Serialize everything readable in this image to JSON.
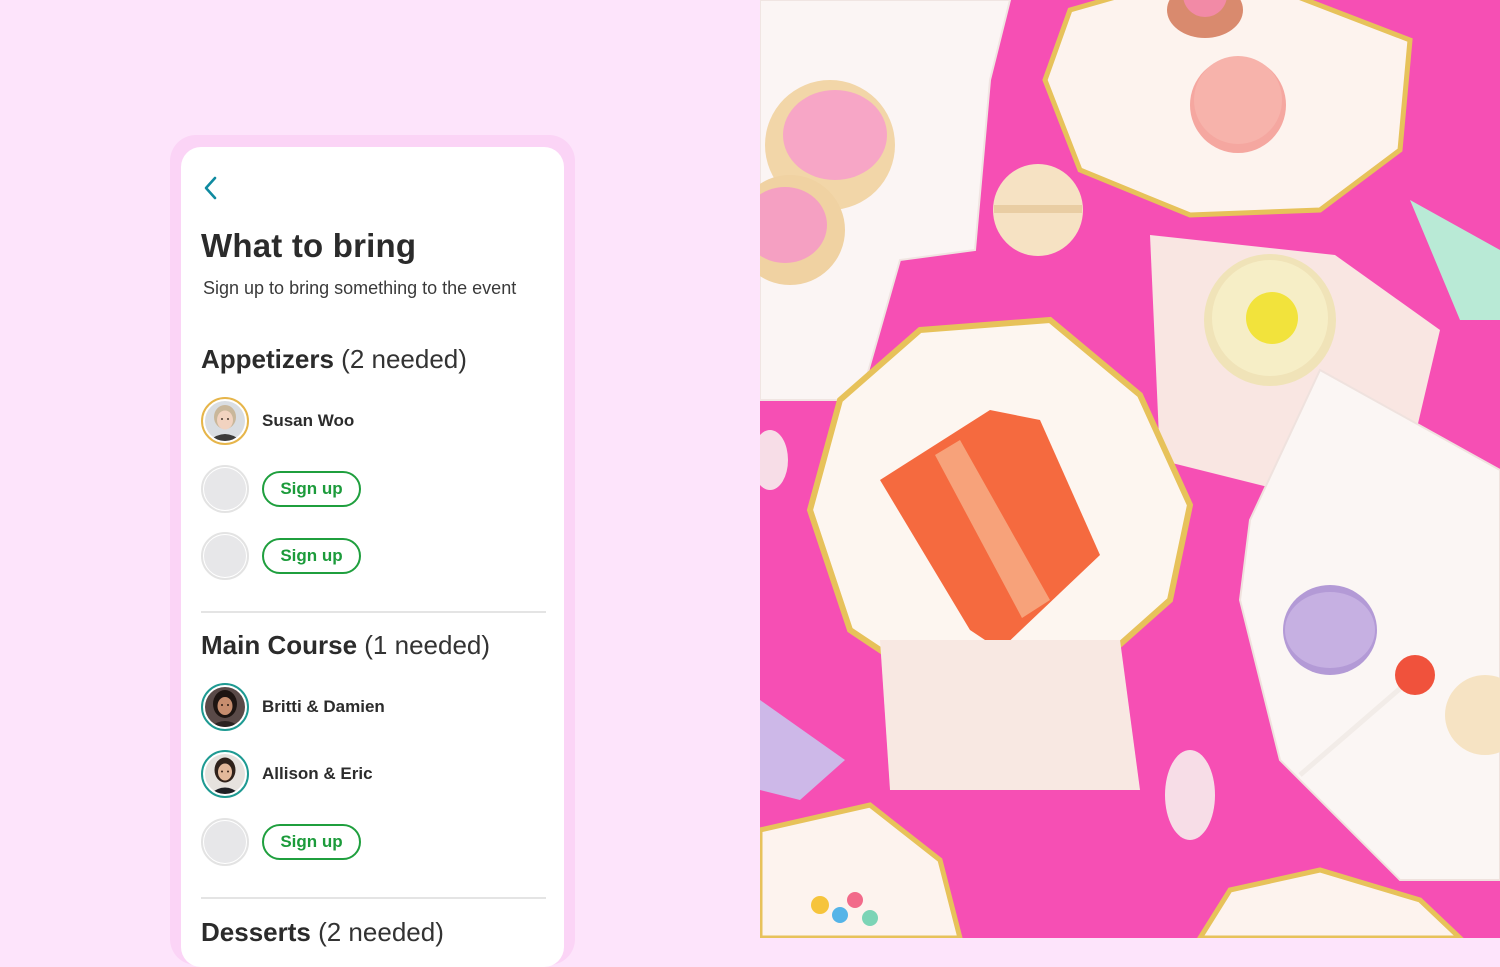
{
  "header": {
    "title": "What to bring",
    "subtitle": "Sign up to bring something to the event"
  },
  "sections": [
    {
      "name": "Appetizers",
      "count": "(2 needed)",
      "slots": [
        {
          "type": "person",
          "name": "Susan Woo"
        },
        {
          "type": "open",
          "button": "Sign up"
        },
        {
          "type": "open",
          "button": "Sign up"
        }
      ]
    },
    {
      "name": "Main Course",
      "count": "(1 needed)",
      "slots": [
        {
          "type": "person",
          "name": "Britti & Damien"
        },
        {
          "type": "person",
          "name": "Allison & Eric"
        },
        {
          "type": "open",
          "button": "Sign up"
        }
      ]
    },
    {
      "name": "Desserts",
      "count": "(2 needed)"
    }
  ],
  "colors": {
    "page_background": "#fde4fb",
    "signup_green": "#1c9b3b",
    "accent_teal": "#0f8aa0",
    "avatar_ring_gold": "#e6b54a",
    "avatar_ring_teal": "#1e9a92",
    "photo_background": "#f64fb4"
  },
  "icons": {
    "back": "chevron-left-icon"
  }
}
